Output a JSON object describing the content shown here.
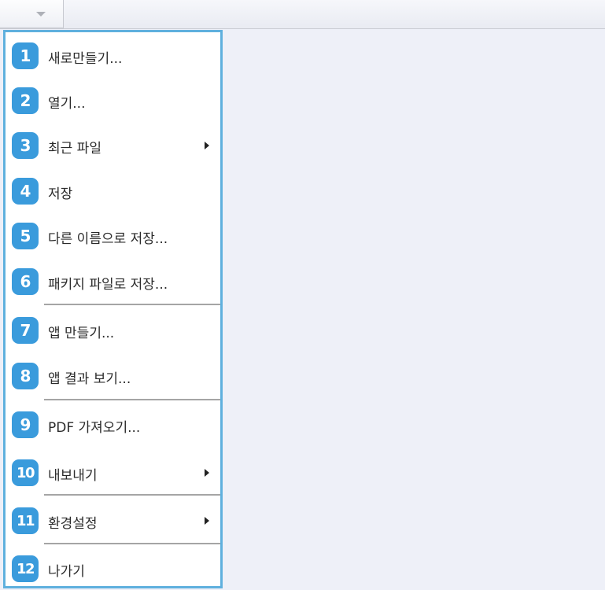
{
  "menu": {
    "items": [
      {
        "num": "1",
        "label": "새로만들기...",
        "submenu": false
      },
      {
        "num": "2",
        "label": "열기...",
        "submenu": false
      },
      {
        "num": "3",
        "label": "최근 파일",
        "submenu": true
      },
      {
        "num": "4",
        "label": "저장",
        "submenu": false
      },
      {
        "num": "5",
        "label": "다른 이름으로 저장...",
        "submenu": false
      },
      {
        "num": "6",
        "label": "패키지 파일로 저장...",
        "submenu": false
      },
      {
        "num": "7",
        "label": "앱 만들기...",
        "submenu": false
      },
      {
        "num": "8",
        "label": "앱 결과 보기...",
        "submenu": false
      },
      {
        "num": "9",
        "label": "PDF 가져오기...",
        "submenu": false
      },
      {
        "num": "10",
        "label": "내보내기",
        "submenu": true
      },
      {
        "num": "11",
        "label": "환경설정",
        "submenu": true
      },
      {
        "num": "12",
        "label": "나가기",
        "submenu": false
      }
    ]
  },
  "icons": {
    "menu_dropdown": "chevron-down-icon",
    "submenu_arrow": "chevron-right-icon"
  },
  "colors": {
    "accent": "#3a9bdc",
    "panel_border": "#5fb0de",
    "workspace": "#eef0f8"
  }
}
